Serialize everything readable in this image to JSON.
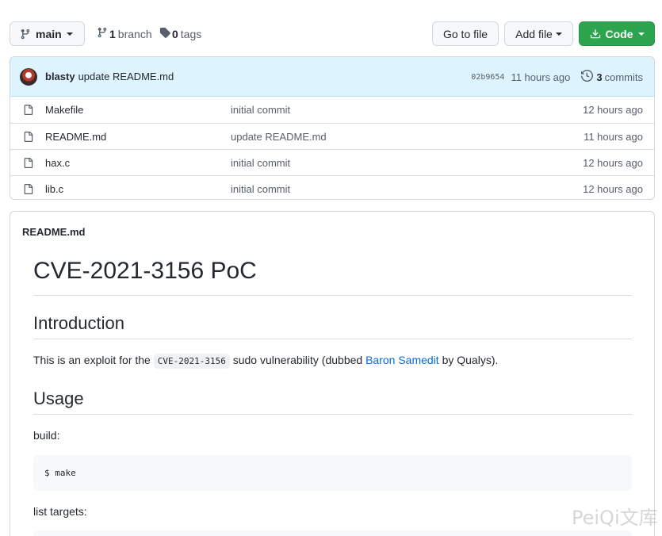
{
  "toolbar": {
    "branch_label": "main",
    "branch_count": "1",
    "branch_word": "branch",
    "tags_count": "0",
    "tags_word": "tags",
    "goto_file_label": "Go to file",
    "add_file_label": "Add file",
    "code_label": "Code"
  },
  "commit": {
    "author": "blasty",
    "message": "update README.md",
    "sha": "02b9654",
    "time": "11 hours ago",
    "commits_count": "3",
    "commits_word": "commits"
  },
  "files": [
    {
      "name": "Makefile",
      "message": "initial commit",
      "age": "12 hours ago",
      "icon": "file-icon"
    },
    {
      "name": "README.md",
      "message": "update README.md",
      "age": "11 hours ago",
      "icon": "file-icon"
    },
    {
      "name": "hax.c",
      "message": "initial commit",
      "age": "12 hours ago",
      "icon": "file-icon"
    },
    {
      "name": "lib.c",
      "message": "initial commit",
      "age": "12 hours ago",
      "icon": "file-icon"
    }
  ],
  "readme": {
    "filename": "README.md",
    "title": "CVE-2021-3156 PoC",
    "intro_heading": "Introduction",
    "intro_text_1": "This is an exploit for the ",
    "intro_code": "CVE-2021-3156",
    "intro_text_2": " sudo vulnerability (dubbed ",
    "intro_link": "Baron Samedit",
    "intro_text_3": " by Qualys).",
    "usage_heading": "Usage",
    "build_label": "build:",
    "build_cmd": "$ make",
    "list_label": "list targets:"
  },
  "watermark": "PeiQi文库",
  "colors": {
    "code_button": "#2da44e",
    "link": "#0969da",
    "commit_bar": "#ddf4ff"
  }
}
